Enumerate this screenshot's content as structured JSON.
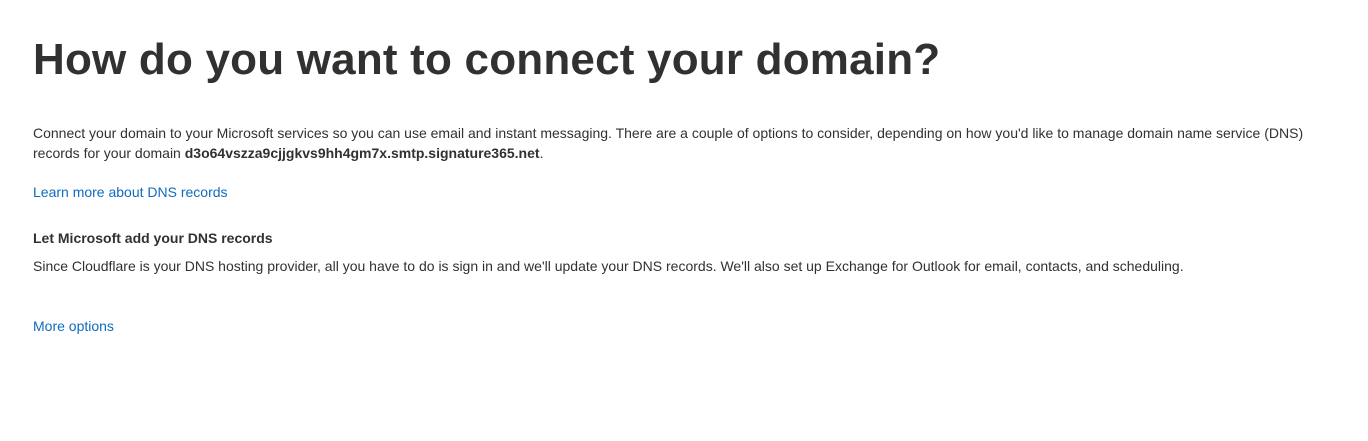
{
  "page": {
    "title": "How do you want to connect your domain?",
    "intro_text": "Connect your domain to your Microsoft services so you can use email and instant messaging. There are a couple of options to consider, depending on how you'd like to manage domain name service (DNS) records for your domain ",
    "domain_name": "d3o64vszza9cjjgkvs9hh4gm7x.smtp.signature365.net",
    "intro_suffix": ".",
    "learn_more_link": "Learn more about DNS records",
    "section_title": "Let Microsoft add your DNS records",
    "section_description": "Since Cloudflare is your DNS hosting provider, all you have to do is sign in and we'll update your DNS records. We'll also set up Exchange for Outlook for email, contacts, and scheduling.",
    "more_options_link": "More options"
  },
  "colors": {
    "text": "#323130",
    "link": "#0f6cbd",
    "background": "#ffffff"
  }
}
